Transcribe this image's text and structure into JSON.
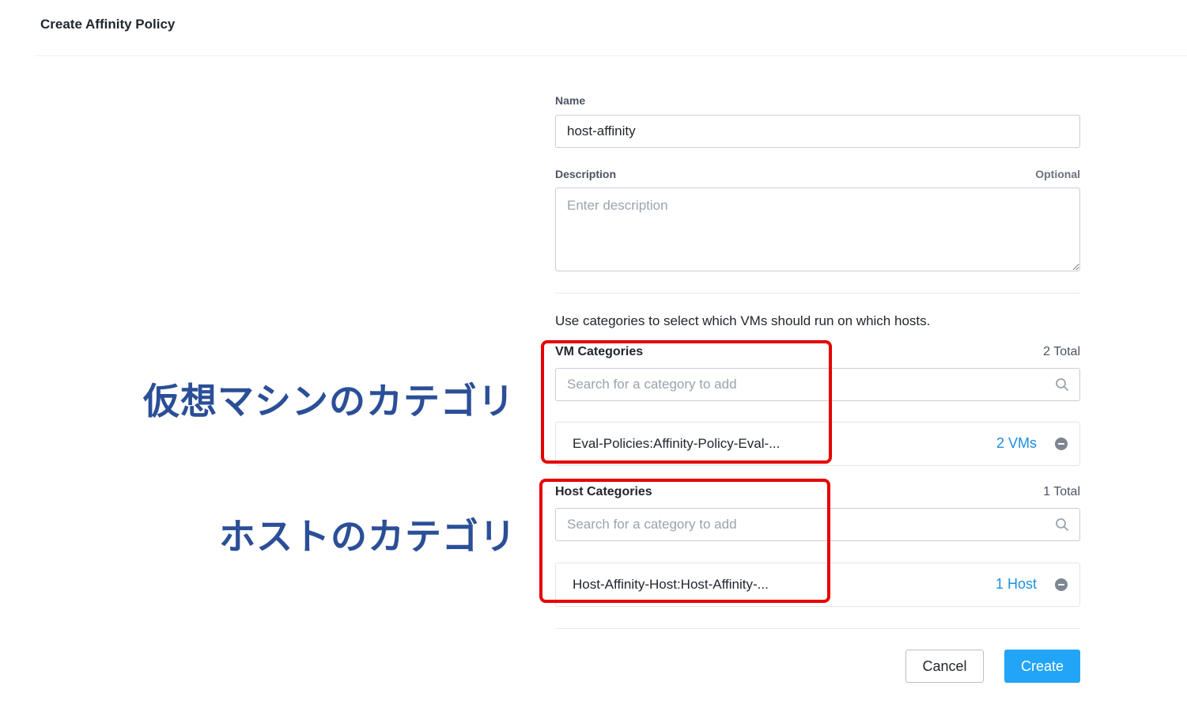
{
  "header": {
    "title": "Create Affinity Policy"
  },
  "form": {
    "name": {
      "label": "Name",
      "value": "host-affinity"
    },
    "description": {
      "label": "Description",
      "optional": "Optional",
      "placeholder": "Enter description"
    },
    "hint": "Use categories to select which VMs should run on which hosts.",
    "vm_categories": {
      "label": "VM Categories",
      "total": "2 Total",
      "search_placeholder": "Search for a category to add",
      "items": [
        {
          "name": "Eval-Policies:Affinity-Policy-Eval-...",
          "count": "2 VMs"
        }
      ]
    },
    "host_categories": {
      "label": "Host Categories",
      "total": "1 Total",
      "search_placeholder": "Search for a category to add",
      "items": [
        {
          "name": "Host-Affinity-Host:Host-Affinity-...",
          "count": "1 Host"
        }
      ]
    }
  },
  "footer": {
    "cancel_label": "Cancel",
    "create_label": "Create"
  },
  "annotations": {
    "vm": "仮想マシンのカテゴリ",
    "host": "ホストのカテゴリ",
    "highlight_color": "#e60000",
    "text_color": "#2b4f97"
  },
  "colors": {
    "accent": "#22a5f7",
    "link": "#1b8fe0"
  },
  "icons": {
    "search": "search-icon",
    "remove": "remove-icon"
  }
}
